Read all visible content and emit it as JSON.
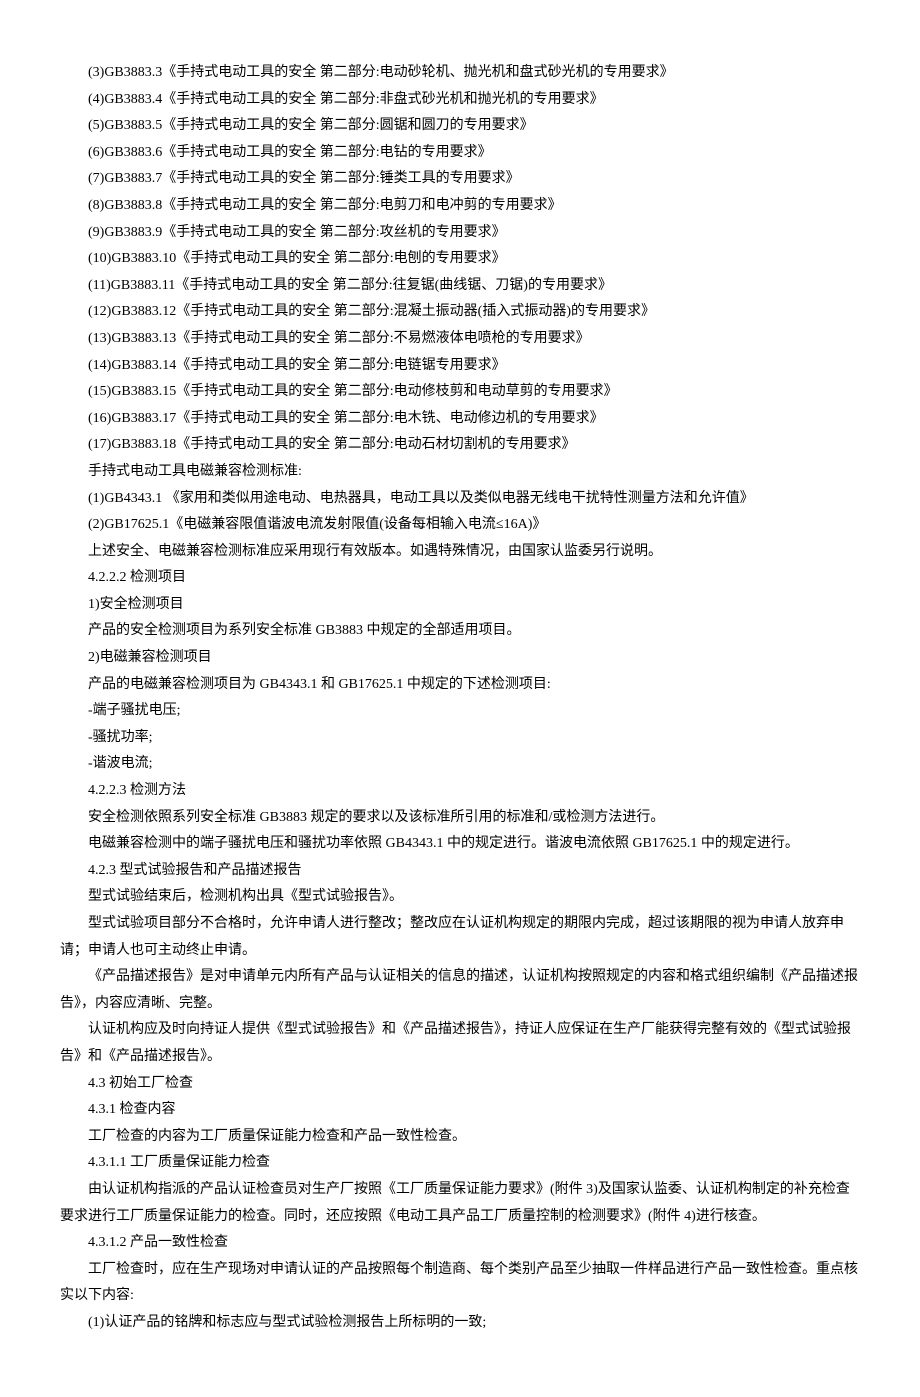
{
  "lines": [
    "(3)GB3883.3《手持式电动工具的安全 第二部分:电动砂轮机、抛光机和盘式砂光机的专用要求》",
    "(4)GB3883.4《手持式电动工具的安全 第二部分:非盘式砂光机和抛光机的专用要求》",
    "(5)GB3883.5《手持式电动工具的安全 第二部分:圆锯和圆刀的专用要求》",
    "(6)GB3883.6《手持式电动工具的安全 第二部分:电钻的专用要求》",
    "(7)GB3883.7《手持式电动工具的安全 第二部分:锤类工具的专用要求》",
    "(8)GB3883.8《手持式电动工具的安全 第二部分:电剪刀和电冲剪的专用要求》",
    "(9)GB3883.9《手持式电动工具的安全 第二部分:攻丝机的专用要求》",
    "(10)GB3883.10《手持式电动工具的安全 第二部分:电刨的专用要求》",
    "(11)GB3883.11《手持式电动工具的安全 第二部分:往复锯(曲线锯、刀锯)的专用要求》",
    "(12)GB3883.12《手持式电动工具的安全 第二部分:混凝土振动器(插入式振动器)的专用要求》",
    "(13)GB3883.13《手持式电动工具的安全 第二部分:不易燃液体电喷枪的专用要求》",
    "(14)GB3883.14《手持式电动工具的安全 第二部分:电链锯专用要求》",
    "(15)GB3883.15《手持式电动工具的安全 第二部分:电动修枝剪和电动草剪的专用要求》",
    "(16)GB3883.17《手持式电动工具的安全 第二部分:电木铣、电动修边机的专用要求》",
    "(17)GB3883.18《手持式电动工具的安全 第二部分:电动石材切割机的专用要求》",
    "手持式电动工具电磁兼容检测标准:",
    "(1)GB4343.1 《家用和类似用途电动、电热器具，电动工具以及类似电器无线电干扰特性测量方法和允许值》",
    "(2)GB17625.1《电磁兼容限值谐波电流发射限值(设备每相输入电流≤16A)》",
    "上述安全、电磁兼容检测标准应采用现行有效版本。如遇特殊情况，由国家认监委另行说明。",
    "4.2.2.2 检测项目",
    "1)安全检测项目",
    "产品的安全检测项目为系列安全标准 GB3883 中规定的全部适用项目。",
    "2)电磁兼容检测项目",
    "产品的电磁兼容检测项目为 GB4343.1 和 GB17625.1 中规定的下述检测项目:",
    "-端子骚扰电压;",
    "-骚扰功率;",
    "-谐波电流;",
    "4.2.2.3 检测方法",
    "安全检测依照系列安全标准 GB3883 规定的要求以及该标准所引用的标准和/或检测方法进行。",
    "电磁兼容检测中的端子骚扰电压和骚扰功率依照 GB4343.1 中的规定进行。谐波电流依照 GB17625.1 中的规定进行。",
    "4.2.3 型式试验报告和产品描述报告",
    "型式试验结束后，检测机构出具《型式试验报告》。",
    "型式试验项目部分不合格时，允许申请人进行整改；整改应在认证机构规定的期限内完成，超过该期限的视为申请人放弃申请；申请人也可主动终止申请。",
    "《产品描述报告》是对申请单元内所有产品与认证相关的信息的描述，认证机构按照规定的内容和格式组织编制《产品描述报告》，内容应清晰、完整。",
    "认证机构应及时向持证人提供《型式试验报告》和《产品描述报告》，持证人应保证在生产厂能获得完整有效的《型式试验报告》和《产品描述报告》。",
    "4.3 初始工厂检查",
    "4.3.1 检查内容",
    "工厂检查的内容为工厂质量保证能力检查和产品一致性检查。",
    "4.3.1.1 工厂质量保证能力检查",
    "由认证机构指派的产品认证检查员对生产厂按照《工厂质量保证能力要求》(附件 3)及国家认监委、认证机构制定的补充检查要求进行工厂质量保证能力的检查。同时，还应按照《电动工具产品工厂质量控制的检测要求》(附件 4)进行核查。",
    "4.3.1.2 产品一致性检查",
    "工厂检查时，应在生产现场对申请认证的产品按照每个制造商、每个类别产品至少抽取一件样品进行产品一致性检查。重点核实以下内容:",
    "(1)认证产品的铭牌和标志应与型式试验检测报告上所标明的一致;"
  ]
}
